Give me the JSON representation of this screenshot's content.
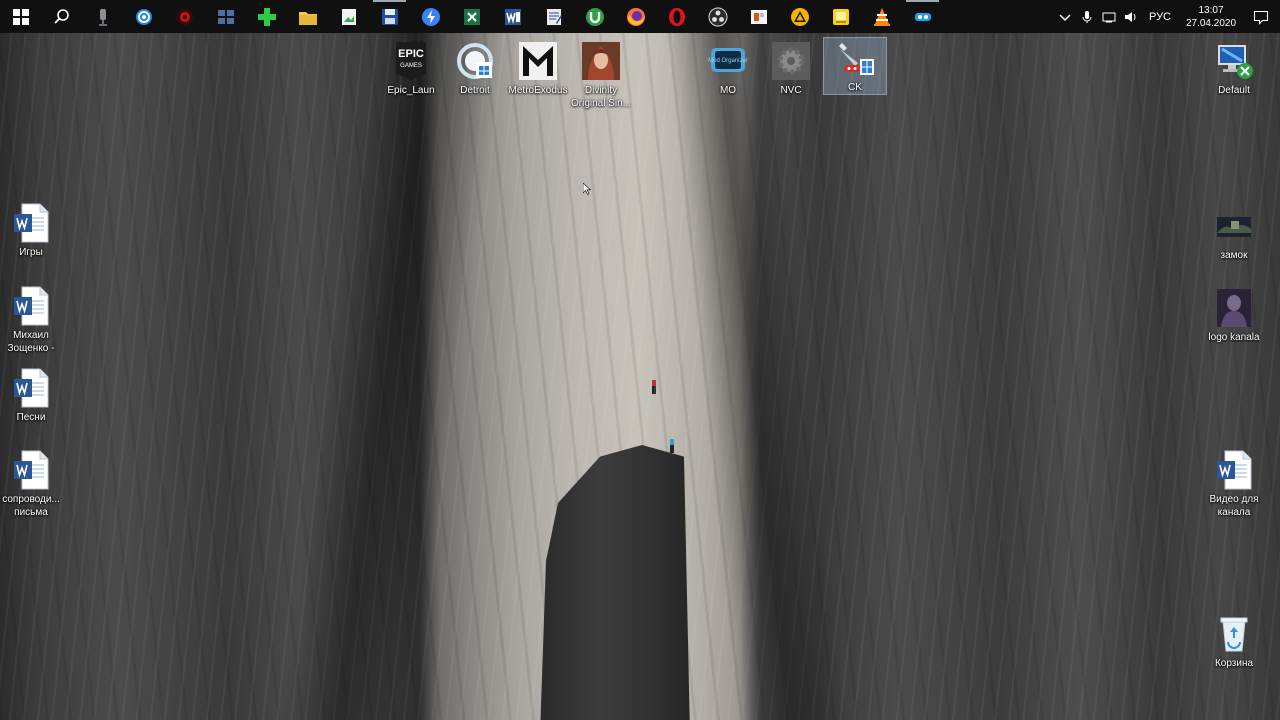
{
  "taskbar": {
    "pinned": [
      {
        "name": "start-icon",
        "active": false
      },
      {
        "name": "search-icon",
        "active": false
      },
      {
        "name": "microphone-app-icon",
        "active": false
      },
      {
        "name": "settings-gear-icon",
        "active": false
      },
      {
        "name": "red-app-icon",
        "active": false
      },
      {
        "name": "windows-tiles-icon",
        "active": false
      },
      {
        "name": "green-plus-icon",
        "active": false
      },
      {
        "name": "file-explorer-icon",
        "active": false
      },
      {
        "name": "image-viewer-icon",
        "active": false
      },
      {
        "name": "save-disk-icon",
        "active": true
      },
      {
        "name": "blue-bolt-icon",
        "active": false
      },
      {
        "name": "excel-icon",
        "active": false
      },
      {
        "name": "word-icon",
        "active": false
      },
      {
        "name": "text-editor-icon",
        "active": false
      },
      {
        "name": "utorrent-icon",
        "active": false
      },
      {
        "name": "firefox-icon",
        "active": false
      },
      {
        "name": "opera-icon",
        "active": false
      },
      {
        "name": "obs-icon",
        "active": false
      },
      {
        "name": "office-icon",
        "active": false
      },
      {
        "name": "warning-app-icon",
        "active": false
      },
      {
        "name": "yellow-app-icon",
        "active": false
      },
      {
        "name": "vlc-icon",
        "active": false
      },
      {
        "name": "blue-game-app-icon",
        "active": true
      }
    ],
    "tray": {
      "language": "РУС",
      "time": "13:07",
      "date": "27.04.2020"
    }
  },
  "desktop": {
    "top_icons": [
      {
        "id": "epic",
        "label": "Epic_Laun",
        "icon": "epic-games-icon",
        "selected": false
      },
      {
        "id": "detroit",
        "label": "Detroit",
        "icon": "detroit-shortcut-icon",
        "selected": false
      },
      {
        "id": "metro",
        "label": "MetroExodus",
        "icon": "metro-exodus-icon",
        "selected": false
      },
      {
        "id": "divinity",
        "label": "Divinity Original Sin...",
        "icon": "divinity-icon",
        "selected": false
      },
      {
        "id": "mo",
        "label": "MO",
        "icon": "mod-organizer-icon",
        "selected": false
      },
      {
        "id": "nvc",
        "label": "NVC",
        "icon": "gear-shortcut-icon",
        "selected": false
      },
      {
        "id": "ck",
        "label": "CK",
        "icon": "creation-kit-icon",
        "selected": true
      }
    ],
    "left_icons": [
      {
        "id": "igry",
        "label": "Игры",
        "icon": "word-document-icon"
      },
      {
        "id": "zoshchenko",
        "label": "Михаил Зощенко -",
        "icon": "word-document-icon"
      },
      {
        "id": "pesni",
        "label": "Песни",
        "icon": "word-document-icon"
      },
      {
        "id": "soprovod",
        "label": "сопроводи... письма",
        "icon": "word-document-icon"
      }
    ],
    "right_icons": [
      {
        "id": "default",
        "label": "Default",
        "icon": "network-computer-icon"
      },
      {
        "id": "zamok",
        "label": "замок",
        "icon": "image-thumbnail-icon"
      },
      {
        "id": "logo",
        "label": "logo kanala",
        "icon": "image-thumbnail-icon"
      },
      {
        "id": "video",
        "label": "Видео для канала",
        "icon": "word-document-icon"
      },
      {
        "id": "trash",
        "label": "Корзина",
        "icon": "recycle-bin-icon"
      }
    ]
  },
  "colors": {
    "taskbar_bg": "#101010",
    "selection": "#a0bedc",
    "word_blue": "#2b5797"
  }
}
